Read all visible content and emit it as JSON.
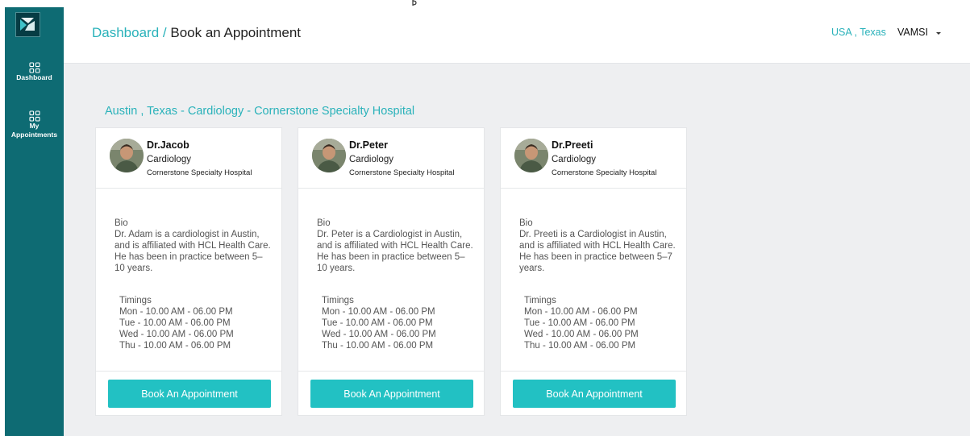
{
  "colors": {
    "sidebar": "#0e6b73",
    "accent": "#2ab2ba",
    "button": "#22c1c3",
    "content_bg": "#eeeff1"
  },
  "sidebar": {
    "logo_icon": "app-logo-icon",
    "items": [
      {
        "label": "Dashboard",
        "icon": "grid-icon"
      },
      {
        "label_line1": "My",
        "label_line2": "Appointments",
        "icon": "grid-icon"
      }
    ]
  },
  "header": {
    "breadcrumb_root": "Dashboard",
    "breadcrumb_sep": "/",
    "breadcrumb_current": "Book an Appointment",
    "location": "USA , Texas",
    "user": "VAMSI"
  },
  "main": {
    "section_title": "Austin , Texas - Cardiology - Cornerstone Specialty Hospital",
    "button_label": "Book An Appointment",
    "bio_heading": "Bio",
    "timings_heading": "Timings",
    "doctors": [
      {
        "name": "Dr.Jacob",
        "specialty": "Cardiology",
        "hospital": "Cornerstone Specialty Hospital",
        "bio": "Dr. Adam is a cardiologist in Austin, and is affiliated with HCL Health Care. He has been in practice between 5–10 years.",
        "timings": [
          "Mon - 10.00 AM - 06.00 PM",
          "Tue - 10.00 AM - 06.00 PM",
          "Wed - 10.00 AM - 06.00 PM",
          "Thu - 10.00 AM - 06.00 PM"
        ]
      },
      {
        "name": "Dr.Peter",
        "specialty": "Cardiology",
        "hospital": "Cornerstone Specialty Hospital",
        "bio": "Dr. Peter is a Cardiologist in Austin, and is affiliated with HCL Health Care. He has been in practice between 5–10 years.",
        "timings": [
          "Mon - 10.00 AM - 06.00 PM",
          "Tue - 10.00 AM - 06.00 PM",
          "Wed - 10.00 AM - 06.00 PM",
          "Thu - 10.00 AM - 06.00 PM"
        ]
      },
      {
        "name": "Dr.Preeti",
        "specialty": "Cardiology",
        "hospital": "Cornerstone Specialty Hospital",
        "bio": "Dr. Preeti is a Cardiologist in Austin, and is affiliated with HCL Health Care. He has been in practice between 5–7 years.",
        "timings": [
          "Mon - 10.00 AM - 06.00 PM",
          "Tue - 10.00 AM - 06.00 PM",
          "Wed - 10.00 AM - 06.00 PM",
          "Thu - 10.00 AM - 06.00 PM"
        ]
      }
    ]
  }
}
